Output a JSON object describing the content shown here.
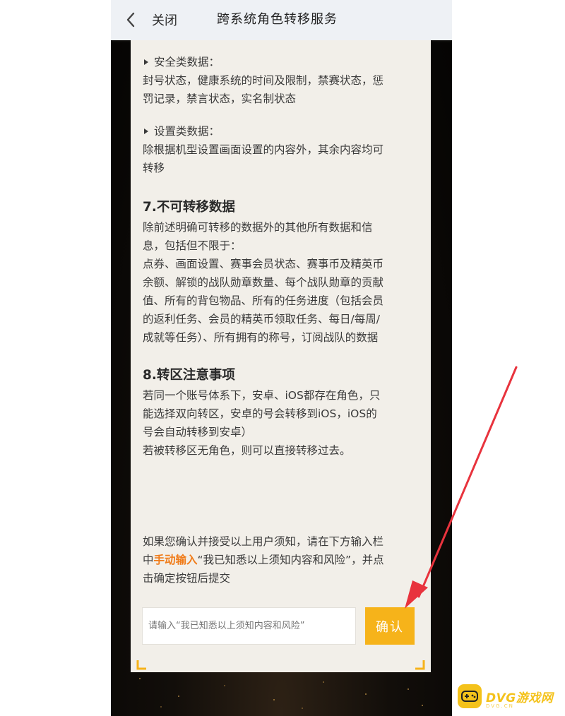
{
  "header": {
    "back_label": "关闭",
    "title": "跨系统角色转移服务"
  },
  "content": {
    "security": {
      "heading": "安全类数据：",
      "body": [
        "封号状态，健康系统的时间及限制，禁赛状态，惩",
        "罚记录，禁言状态，实名制状态"
      ]
    },
    "settings": {
      "heading": "设置类数据：",
      "body": [
        "除根据机型设置画面设置的内容外，其余内容均可",
        "转移"
      ]
    },
    "section7": {
      "title": "7.不可转移数据",
      "body": [
        "除前述明确可转移的数据外的其他所有数据和信",
        "息，包括但不限于：",
        "点券、画面设置、赛事会员状态、赛事币及精英币",
        "余额、解锁的战队勋章数量、每个战队勋章的贡献",
        "值、所有的背包物品、所有的任务进度（包括会员",
        "的返利任务、会员的精英币领取任务、每日/每周/",
        "成就等任务）、所有拥有的称号，订阅战队的数据"
      ]
    },
    "section8": {
      "title": "8.转区注意事项",
      "body": [
        "若同一个账号体系下，安卓、iOS都存在角色，只",
        "能选择双向转区，安卓的号会转移到iOS，iOS的",
        "号会自动转移到安卓）",
        "若被转移区无角色，则可以直接转移过去。"
      ]
    },
    "notice": {
      "line1": "如果您确认并接受以上用户须知，请在下方输入栏",
      "line2_prefix": "中",
      "line2_highlight": "手动输入",
      "line2_suffix": "“我已知悉以上须知内容和风险”，并点",
      "line3": "击确定按钮后提交"
    }
  },
  "form": {
    "placeholder": "请输入“我已知悉以上须知内容和风险”",
    "confirm_label": "确认"
  },
  "watermark": {
    "text": "DVG游戏网",
    "sub": "DVG.CN"
  },
  "colors": {
    "accent": "#f6b31a",
    "highlight": "#f07c1a",
    "arrow": "#e8333d"
  }
}
